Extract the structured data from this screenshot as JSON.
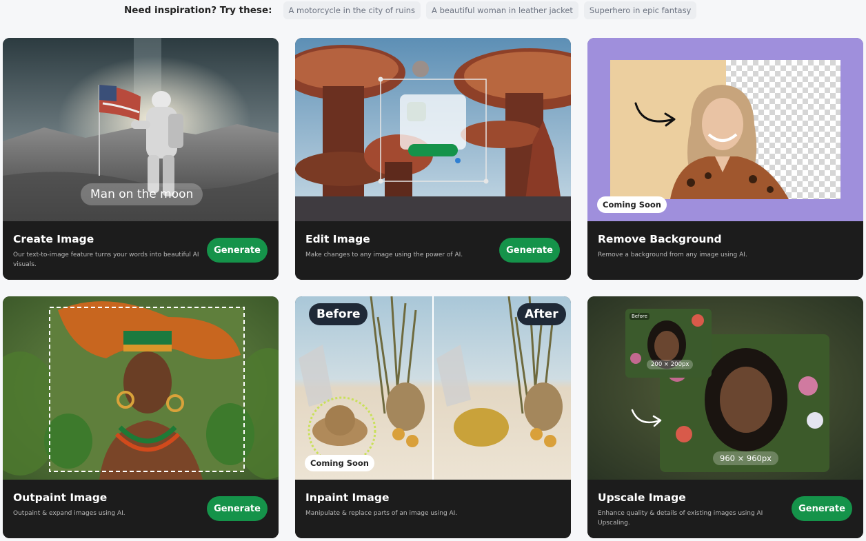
{
  "inspiration": {
    "label": "Need inspiration? Try these:",
    "chips": [
      "A motorcycle in the city of ruins",
      "A beautiful woman in leather jacket",
      "Superhero in epic fantasy"
    ]
  },
  "cards": [
    {
      "title": "Create Image",
      "description": "Our text-to-image feature turns your words into beautiful AI visuals.",
      "button": "Generate",
      "overlay_text": "Man on the moon"
    },
    {
      "title": "Edit Image",
      "description": "Make changes to any image using the power of AI.",
      "button": "Generate"
    },
    {
      "title": "Remove Background",
      "description": "Remove a background from any image using AI.",
      "badge": "Coming Soon"
    },
    {
      "title": "Outpaint Image",
      "description": "Outpaint & expand images using AI.",
      "button": "Generate"
    },
    {
      "title": "Inpaint Image",
      "description": "Manipulate & replace parts of an image using AI.",
      "badge": "Coming Soon",
      "before_label": "Before",
      "after_label": "After"
    },
    {
      "title": "Upscale Image",
      "description": "Enhance quality & details of existing images using AI Upscaling.",
      "button": "Generate",
      "small_label": "200 × 200px",
      "large_label": "960 × 960px",
      "before_tag": "Before"
    }
  ],
  "colors": {
    "accent_green": "#15934a",
    "card_footer": "#1c1c1c",
    "purple_bg": "#9f8fdc"
  }
}
